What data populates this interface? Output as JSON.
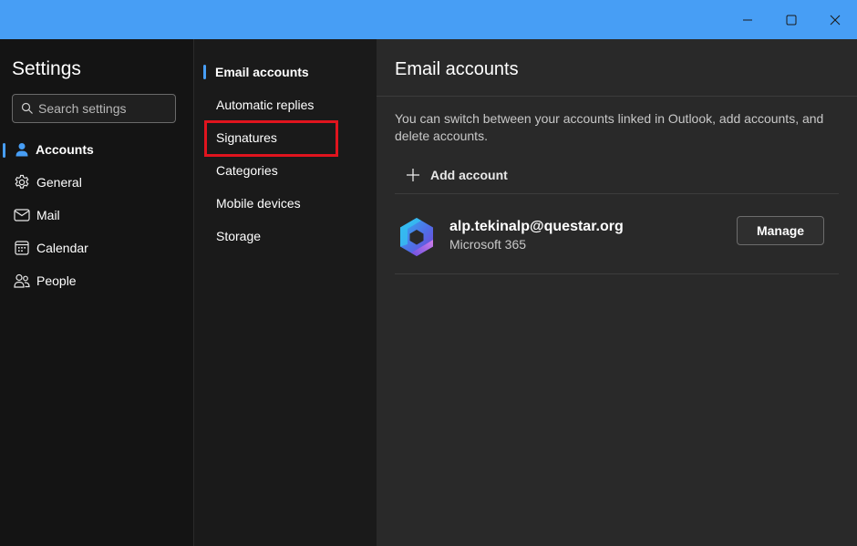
{
  "titlebar": {
    "color": "#479ef5",
    "controls": [
      "minimize-icon",
      "maximize-icon",
      "close-icon"
    ]
  },
  "sidebar": {
    "title": "Settings",
    "search_placeholder": "Search settings",
    "items": [
      {
        "label": "Accounts",
        "icon": "person-icon",
        "active": true
      },
      {
        "label": "General",
        "icon": "gear-icon",
        "active": false
      },
      {
        "label": "Mail",
        "icon": "mail-icon",
        "active": false
      },
      {
        "label": "Calendar",
        "icon": "calendar-icon",
        "active": false
      },
      {
        "label": "People",
        "icon": "people-icon",
        "active": false
      }
    ]
  },
  "submenu": {
    "items": [
      {
        "label": "Email accounts",
        "active": true
      },
      {
        "label": "Automatic replies",
        "active": false
      },
      {
        "label": "Signatures",
        "active": false,
        "highlighted": true
      },
      {
        "label": "Categories",
        "active": false
      },
      {
        "label": "Mobile devices",
        "active": false
      },
      {
        "label": "Storage",
        "active": false
      }
    ]
  },
  "main": {
    "heading": "Email accounts",
    "description": "You can switch between your accounts linked in Outlook, add accounts, and delete accounts.",
    "add_account_label": "Add account",
    "account": {
      "email": "alp.tekinalp@questar.org",
      "type": "Microsoft 365",
      "logo": "microsoft-365-logo"
    },
    "manage_label": "Manage"
  },
  "colors": {
    "accent": "#479ef5",
    "highlight": "#e0141e"
  }
}
